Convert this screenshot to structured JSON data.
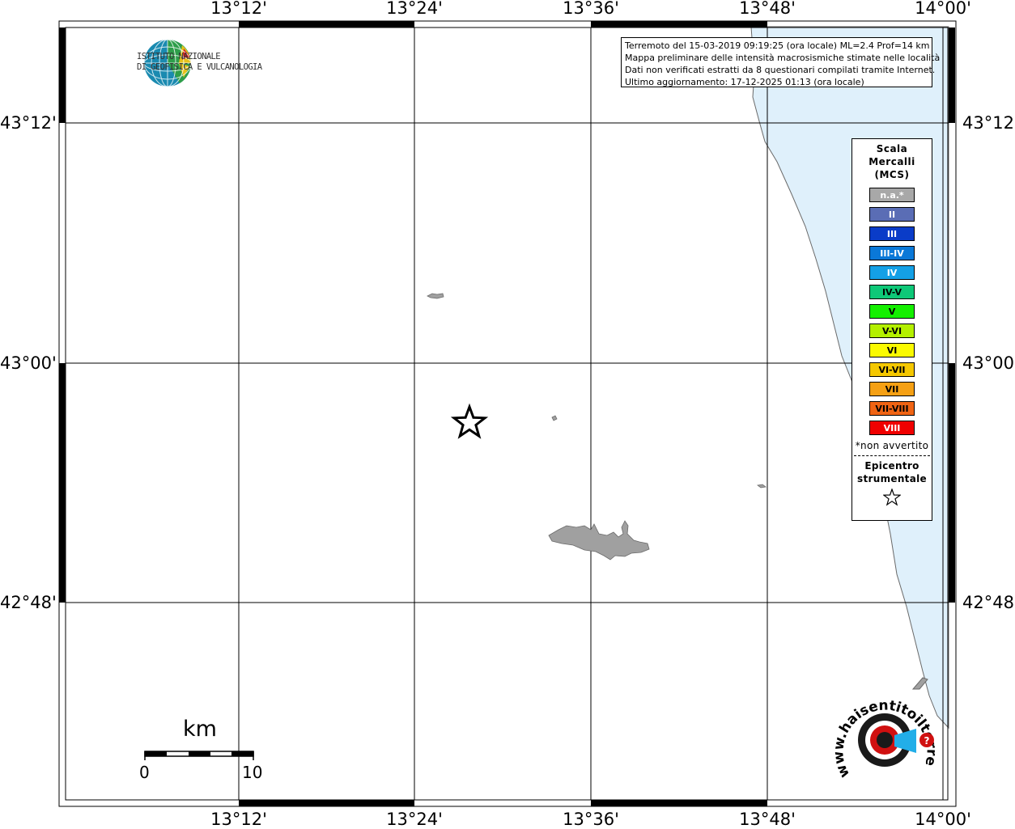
{
  "map": {
    "lon_labels": [
      "13°12'",
      "13°24'",
      "13°36'",
      "13°48'",
      "14°00'"
    ],
    "lat_labels": [
      "43°12'",
      "43°00'",
      "42°48'"
    ],
    "colors": {
      "land": "#ffffff",
      "sea": "#dff0fb",
      "islands": "#a0a0a0",
      "grid": "#000000"
    }
  },
  "logo": {
    "line1": "ISTITUTO NAZIONALE",
    "line2": "DI GEOFISICA E VULCANOLOGIA"
  },
  "info": {
    "line1": "Terremoto del 15-03-2019 09:19:25 (ora locale) ML=2.4 Prof=14 km",
    "line2": "Mappa preliminare delle intensità macrosismiche stimate nelle località",
    "line3": "Dati non verificati estratti da 8 questionari compilati tramite Internet.",
    "line4": "Ultimo aggiornamento: 17-12-2025 01:13 (ora locale)"
  },
  "legend": {
    "title1": "Scala",
    "title2": "Mercalli",
    "title3": "(MCS)",
    "items": [
      {
        "label": "n.a.*",
        "color": "#a8a8a8",
        "text_color": "#ffffff"
      },
      {
        "label": "II",
        "color": "#5a6db5",
        "text_color": "#ffffff"
      },
      {
        "label": "III",
        "color": "#0a3cc8",
        "text_color": "#ffffff"
      },
      {
        "label": "III-IV",
        "color": "#0a78d8",
        "text_color": "#ffffff"
      },
      {
        "label": "IV",
        "color": "#14a0e6",
        "text_color": "#ffffff"
      },
      {
        "label": "IV-V",
        "color": "#0ec878",
        "text_color": "#000000"
      },
      {
        "label": "V",
        "color": "#14f000",
        "text_color": "#000000"
      },
      {
        "label": "V-VI",
        "color": "#b4f000",
        "text_color": "#000000"
      },
      {
        "label": "VI",
        "color": "#fafa00",
        "text_color": "#000000"
      },
      {
        "label": "VI-VII",
        "color": "#f5c800",
        "text_color": "#000000"
      },
      {
        "label": "VII",
        "color": "#f5a014",
        "text_color": "#000000"
      },
      {
        "label": "VII-VIII",
        "color": "#f06414",
        "text_color": "#000000"
      },
      {
        "label": "VIII",
        "color": "#f00000",
        "text_color": "#ffffff"
      }
    ],
    "note": "*non avvertito",
    "epi1": "Epicentro",
    "epi2": "strumentale"
  },
  "scale": {
    "unit": "km",
    "start": "0",
    "end": "10"
  },
  "badge": {
    "text": "www.haisentitoilterremoto.it",
    "icon": "question-mark-icon"
  }
}
